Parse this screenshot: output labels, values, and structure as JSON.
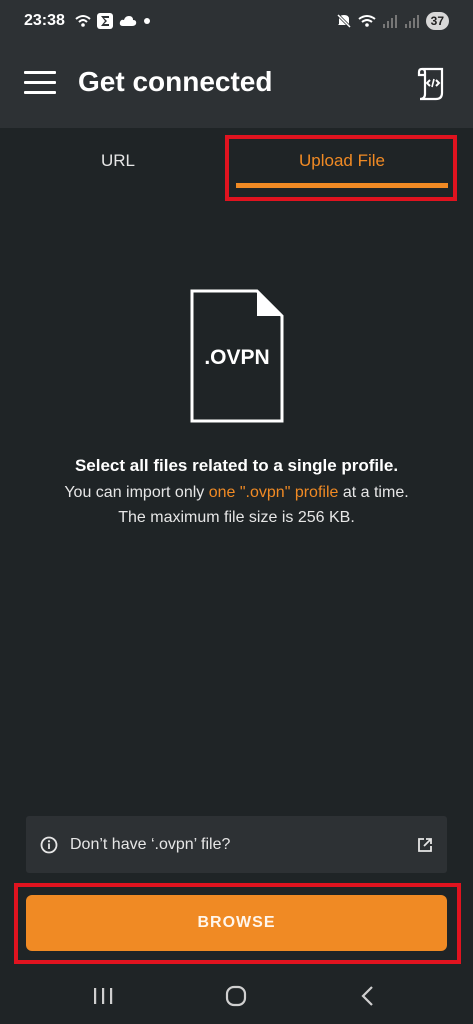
{
  "status_bar": {
    "time": "23:38",
    "battery": "37",
    "icons": [
      "wifi-icon",
      "sigma-app-icon",
      "cloud-icon",
      "dot-icon",
      "mute-icon",
      "wifi-signal-icon",
      "cell-signal-icon",
      "cell-signal-icon"
    ]
  },
  "app_bar": {
    "title": "Get connected",
    "menu_icon": "hamburger-icon",
    "action_icon": "script-icon"
  },
  "tabs": [
    {
      "label": "URL",
      "selected": false
    },
    {
      "label": "Upload File",
      "selected": true
    }
  ],
  "file_graphic": {
    "label": ".OVPN"
  },
  "message": {
    "title": "Select all files related to a single profile.",
    "line1_prefix": "You can import only ",
    "line1_accent": "one \".ovpn\" profile",
    "line1_suffix": " at a time.",
    "line2": "The maximum file size is 256 KB."
  },
  "help": {
    "label": "Don’t have ‘.ovpn’ file?",
    "icon": "info-icon",
    "action_icon": "external-link-icon"
  },
  "browse": {
    "label": "BROWSE"
  },
  "colors": {
    "accent": "#f08a24",
    "background": "#1f2426",
    "bar": "#2d3134",
    "highlight": "#e0131f"
  },
  "nav_bar": {
    "icons": [
      "recent-apps-icon",
      "home-icon",
      "back-icon"
    ]
  }
}
